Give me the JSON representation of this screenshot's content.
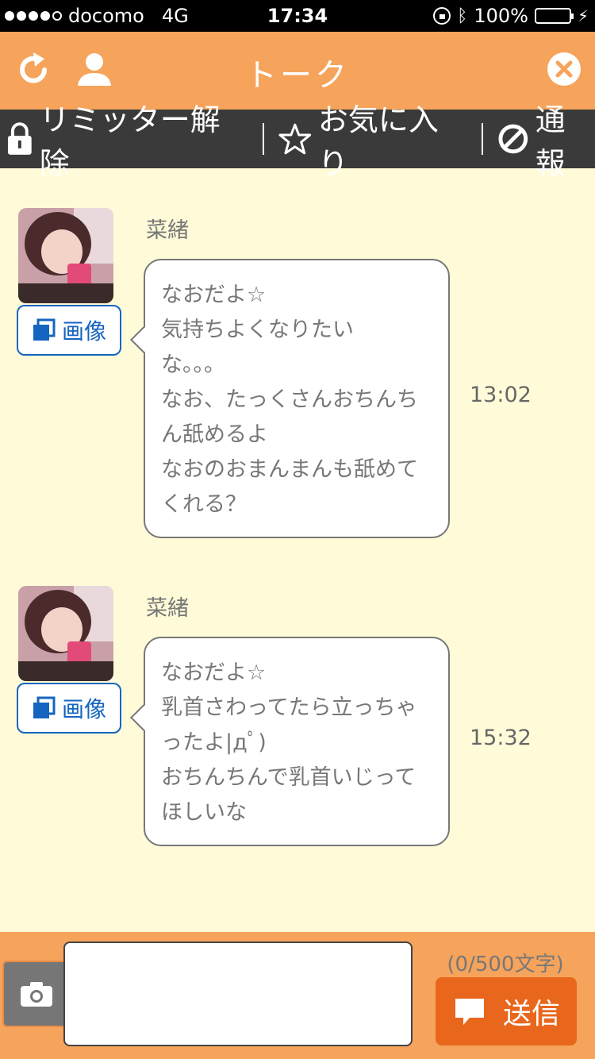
{
  "status_bar": {
    "carrier": "docomo",
    "network": "4G",
    "time": "17:34",
    "battery": "100%",
    "battery_level": 1.0,
    "signal_bars": 4,
    "icons": [
      "rotation-lock-icon",
      "bluetooth-icon",
      "battery-icon",
      "charging-icon"
    ]
  },
  "header": {
    "title": "トーク",
    "icons": [
      "reload-icon",
      "user-icon",
      "close-icon"
    ]
  },
  "toolbar": {
    "limiter_label": "リミッター解除",
    "favorite_label": "お気に入り",
    "report_label": "通報"
  },
  "messages": [
    {
      "sender": "菜緒",
      "image_button_label": "画像",
      "lines": [
        "なおだよ☆",
        "気持ちよくなりたい",
        "な。。。",
        "なお、たっくさんおちんち",
        "ん舐めるよ",
        "なおのおまんまんも舐めて",
        "くれる？"
      ],
      "time": "13:02"
    },
    {
      "sender": "菜緒",
      "image_button_label": "画像",
      "lines": [
        "なおだよ☆",
        "乳首さわってたら立っちゃ",
        "ったよ|дﾟ)",
        "おちんちんで乳首いじって",
        "ほしいな"
      ],
      "time": "15:32"
    }
  ],
  "composer": {
    "input_value": "",
    "char_count": "(0/500文字)",
    "send_label": "送信"
  },
  "colors": {
    "header_bg": "#f6a35b",
    "toolbar_bg": "#3a3a3a",
    "chat_bg": "#fffbd9",
    "send_bg": "#e8671c",
    "image_button": "#1565c0"
  }
}
